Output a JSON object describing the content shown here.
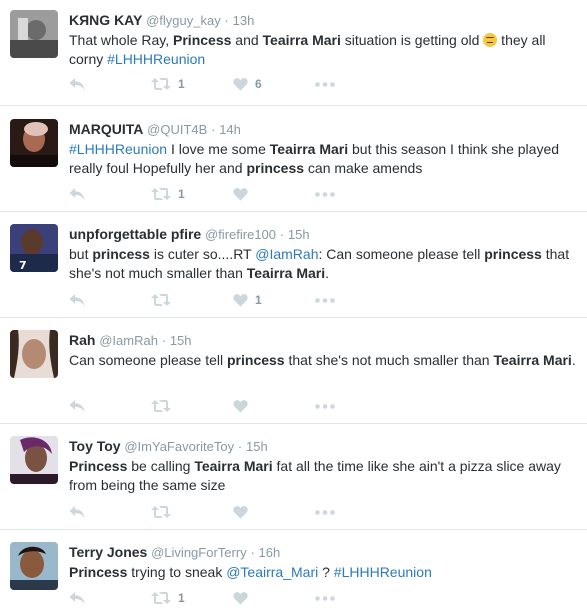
{
  "colors": {
    "text": "#292f33",
    "muted": "#8899a6",
    "link": "#2b7bb9",
    "icon": "#ccd6dd",
    "divider": "#e1e8ed"
  },
  "tweets": [
    {
      "name": "KЯNG KAY",
      "handle": "@flyguy_kay",
      "sep": "·",
      "time": "13h",
      "segments": [
        {
          "t": "That whole Ray, "
        },
        {
          "t": "Princess",
          "b": true
        },
        {
          "t": " and "
        },
        {
          "t": "Teairra Mari",
          "b": true
        },
        {
          "t": " situation is getting old "
        },
        {
          "t": "",
          "emoji": "unamused-face"
        },
        {
          "t": " they all corny "
        },
        {
          "t": "#LHHHReunion",
          "link": true
        }
      ],
      "retweets": "1",
      "likes": "6"
    },
    {
      "name": "MARQUITA",
      "handle": "@QUIT4B",
      "sep": "·",
      "time": "14h",
      "segments": [
        {
          "t": "#LHHHReunion",
          "link": true
        },
        {
          "t": " I love me some "
        },
        {
          "t": "Teairra Mari",
          "b": true
        },
        {
          "t": " but this season I think she played really foul Hopefully her and "
        },
        {
          "t": "princess",
          "b": true
        },
        {
          "t": " can make amends"
        }
      ],
      "retweets": "1",
      "likes": ""
    },
    {
      "name": "unpforgettable pfire",
      "handle": "@firefire100",
      "sep": "·",
      "time": "15h",
      "segments": [
        {
          "t": "but "
        },
        {
          "t": "princess",
          "b": true
        },
        {
          "t": " is cuter so....RT "
        },
        {
          "t": "@IamRah",
          "link": true
        },
        {
          "t": ": Can someone please tell "
        },
        {
          "t": "princess",
          "b": true
        },
        {
          "t": " that she's not much smaller than "
        },
        {
          "t": "Teairra Mari",
          "b": true
        },
        {
          "t": "."
        }
      ],
      "retweets": "",
      "likes": "1"
    },
    {
      "name": "Rah",
      "handle": "@IamRah",
      "sep": "·",
      "time": "15h",
      "segments": [
        {
          "t": "Can someone please tell "
        },
        {
          "t": "princess",
          "b": true
        },
        {
          "t": " that she's not much smaller than "
        },
        {
          "t": "Teairra Mari",
          "b": true
        },
        {
          "t": "."
        }
      ],
      "retweets": "",
      "likes": ""
    },
    {
      "name": "Toy Toy",
      "handle": "@ImYaFavoriteToy",
      "sep": "·",
      "time": "15h",
      "segments": [
        {
          "t": "Princess",
          "b": true
        },
        {
          "t": " be calling "
        },
        {
          "t": "Teairra Mari",
          "b": true
        },
        {
          "t": " fat all the time like she ain't a pizza slice away from being the same size"
        }
      ],
      "retweets": "",
      "likes": ""
    },
    {
      "name": "Terry Jones",
      "handle": "@LivingForTerry",
      "sep": "·",
      "time": "16h",
      "segments": [
        {
          "t": "Princess",
          "b": true
        },
        {
          "t": " trying to sneak "
        },
        {
          "t": "@Teairra_Mari",
          "link": true
        },
        {
          "t": " ? "
        },
        {
          "t": "#LHHHReunion",
          "link": true
        }
      ],
      "retweets": "1",
      "likes": ""
    }
  ]
}
